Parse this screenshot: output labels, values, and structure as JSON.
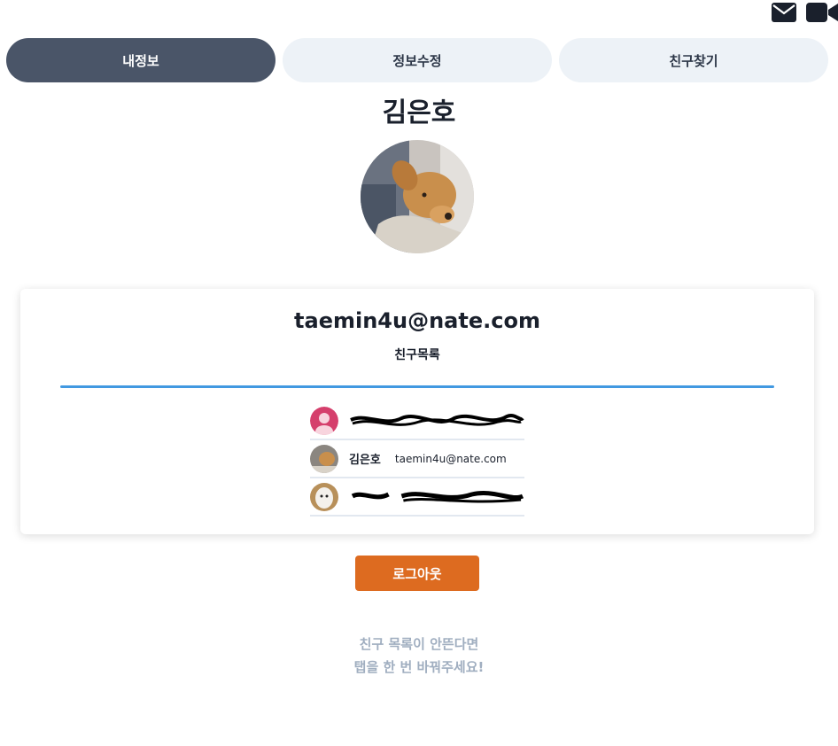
{
  "header": {
    "icons": [
      "mail-icon",
      "video-camera-icon"
    ]
  },
  "tabs": [
    {
      "label": "내정보",
      "active": true
    },
    {
      "label": "정보수정",
      "active": false
    },
    {
      "label": "친구찾기",
      "active": false
    }
  ],
  "profile": {
    "name": "김은호",
    "email": "taemin4u@nate.com"
  },
  "friends": {
    "title": "친구목록",
    "items": [
      {
        "name": "",
        "email": "",
        "redacted": true
      },
      {
        "name": "김은호",
        "email": "taemin4u@nate.com",
        "redacted": false
      },
      {
        "name": "",
        "email": "",
        "redacted": true
      }
    ]
  },
  "actions": {
    "logout_label": "로그아웃"
  },
  "notice": {
    "line1": "친구 목록이 안뜬다면",
    "line2": "탭을 한 번 바꿔주세요!"
  },
  "colors": {
    "active_tab": "#4a5568",
    "inactive_tab": "#edf2f7",
    "divider": "#4299e1",
    "logout": "#dd6b20",
    "hint": "#a0aec0"
  }
}
